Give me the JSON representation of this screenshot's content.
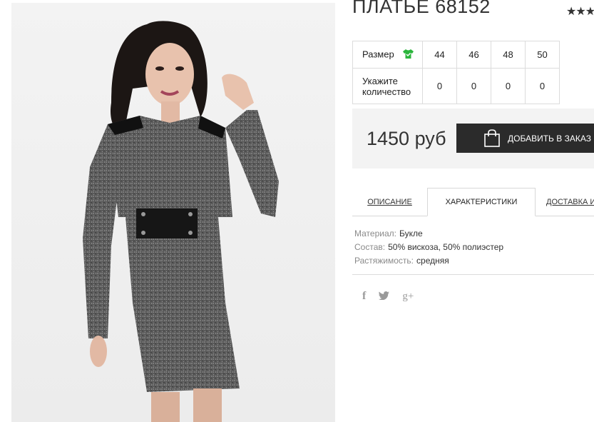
{
  "product": {
    "title": "ПЛАТЬЕ 68152",
    "rating_stars": "★★★"
  },
  "sizes": {
    "size_label": "Размер",
    "qty_label": "Укажите количество",
    "columns": [
      "44",
      "46",
      "48",
      "50"
    ],
    "quantities": [
      "0",
      "0",
      "0",
      "0"
    ],
    "size_icon": "tshirt-icon"
  },
  "purchase": {
    "price": "1450 руб",
    "order_button": "ДОБАВИТЬ В ЗАКАЗ",
    "button_icon": "shopping-bag-icon"
  },
  "tabs": [
    {
      "label": "ОПИСАНИЕ",
      "active": false
    },
    {
      "label": "ХАРАКТЕРИСТИКИ",
      "active": true
    },
    {
      "label": "ДОСТАВКА И",
      "active": false
    }
  ],
  "specs": [
    {
      "key": "Материал:",
      "value": "Букле"
    },
    {
      "key": "Состав:",
      "value": "50% вискоза, 50% полиэстер"
    },
    {
      "key": "Растяжимость:",
      "value": "средняя"
    }
  ],
  "social": {
    "facebook": "f",
    "twitter": "twitter-icon",
    "googleplus": "g+"
  },
  "colors": {
    "accent_green": "#2bb53c",
    "button_bg": "#2b2b2b",
    "price_bg": "#f3f3f3"
  }
}
